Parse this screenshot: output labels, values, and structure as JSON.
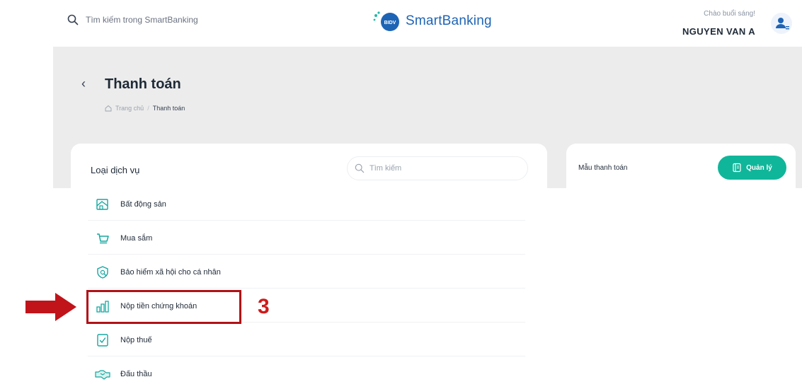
{
  "header": {
    "search_placeholder": "Tìm kiếm trong SmartBanking",
    "logo_text": "SmartBanking",
    "logo_badge": "BIDV",
    "greeting": "Chào buổi sáng!",
    "user_name": "NGUYEN VAN A"
  },
  "page": {
    "title": "Thanh toán",
    "breadcrumb": {
      "home": "Trang chủ",
      "separator": "/",
      "current": "Thanh toán"
    }
  },
  "services_panel": {
    "label": "Loại dịch vụ",
    "search_placeholder": "Tìm kiếm",
    "items": [
      {
        "label": "Bất động sản",
        "icon": "real-estate-icon"
      },
      {
        "label": "Mua sắm",
        "icon": "shopping-cart-icon"
      },
      {
        "label": "Bảo hiểm xã hội cho cá nhân",
        "icon": "insurance-icon"
      },
      {
        "label": "Nộp tiền chứng khoán",
        "icon": "stock-chart-icon"
      },
      {
        "label": "Nộp thuế",
        "icon": "tax-icon"
      },
      {
        "label": "Đấu thầu",
        "icon": "handshake-icon"
      }
    ]
  },
  "templates_panel": {
    "label": "Mẫu thanh toán",
    "manage_button": "Quản lý"
  },
  "annotation": {
    "step": "3"
  },
  "colors": {
    "brand_blue": "#1e64b5",
    "accent_green": "#10b69a",
    "icon_teal": "#16a7a0",
    "highlight_red": "#b11116"
  }
}
